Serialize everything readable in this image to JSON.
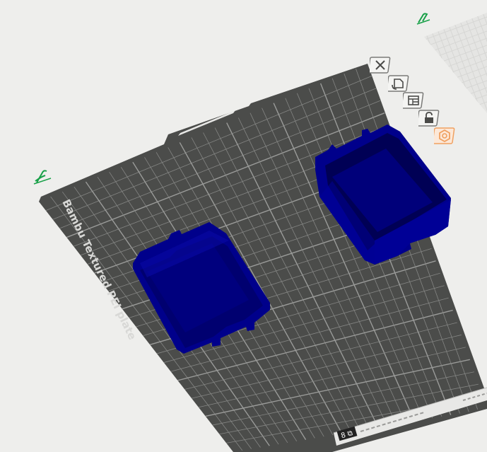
{
  "plate": {
    "label": "Bambu Textured PEI plate",
    "colors": {
      "plate_surface": "#4b4c4a",
      "plate_edge": "#2e2f2e",
      "grid_line": "#858684",
      "grid_major": "#9a9b99",
      "label_text": "#d8d8d6",
      "object_fill": "#00008b",
      "object_dark": "#000050",
      "object_rim": "#1a1ab4",
      "background": "#eeeeec"
    }
  },
  "toolbar": {
    "buttons": [
      {
        "name": "arrange-objects-icon",
        "active": false
      },
      {
        "name": "orient-objects-icon",
        "active": false
      },
      {
        "name": "plate-settings-icon",
        "active": false
      },
      {
        "name": "lock-plate-icon",
        "active": false
      },
      {
        "name": "plate-type-icon",
        "active": true
      }
    ],
    "active_color": "#f0a060"
  },
  "markers": {
    "edit_color": "#18a048"
  },
  "footer": {
    "plate_number_icon": "plate-number-icon"
  }
}
